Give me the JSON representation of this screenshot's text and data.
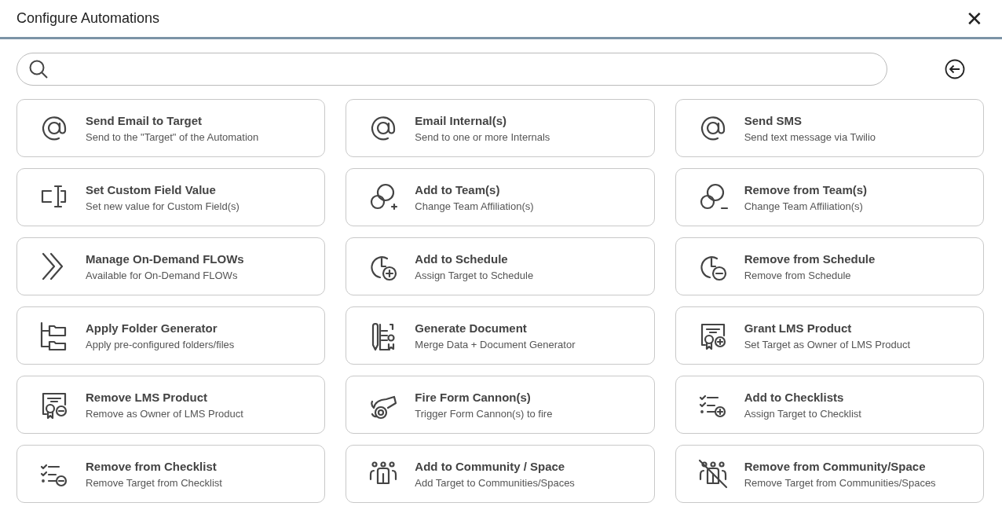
{
  "dialog": {
    "title": "Configure Automations",
    "close_symbol": "✕"
  },
  "automations": [
    {
      "kind": "at",
      "title": "Send Email to Target",
      "subtitle": "Send to the \"Target\" of the Automation"
    },
    {
      "kind": "at",
      "title": "Email Internal(s)",
      "subtitle": "Send to one or more Internals"
    },
    {
      "kind": "at",
      "title": "Send SMS",
      "subtitle": "Send text message via Twilio"
    },
    {
      "kind": "field",
      "title": "Set Custom Field Value",
      "subtitle": "Set new value for Custom Field(s)"
    },
    {
      "kind": "team-add",
      "title": "Add to Team(s)",
      "subtitle": "Change Team Affiliation(s)"
    },
    {
      "kind": "team-remove",
      "title": "Remove from Team(s)",
      "subtitle": "Change Team Affiliation(s)"
    },
    {
      "kind": "chevrons",
      "title": "Manage On-Demand FLOWs",
      "subtitle": "Available for On-Demand FLOWs"
    },
    {
      "kind": "schedule-add",
      "title": "Add to Schedule",
      "subtitle": "Assign Target to Schedule"
    },
    {
      "kind": "schedule-remove",
      "title": "Remove from Schedule",
      "subtitle": "Remove from Schedule"
    },
    {
      "kind": "folders",
      "title": "Apply Folder Generator",
      "subtitle": "Apply pre-configured folders/files"
    },
    {
      "kind": "document",
      "title": "Generate Document",
      "subtitle": "Merge Data + Document Generator"
    },
    {
      "kind": "certificate-add",
      "title": "Grant LMS Product",
      "subtitle": "Set Target as Owner of LMS Product"
    },
    {
      "kind": "certificate-remove",
      "title": "Remove LMS Product",
      "subtitle": "Remove as Owner of LMS Product"
    },
    {
      "kind": "cannon",
      "title": "Fire Form Cannon(s)",
      "subtitle": "Trigger Form Cannon(s) to fire"
    },
    {
      "kind": "checklist-add",
      "title": "Add to Checklists",
      "subtitle": "Assign Target to Checklist"
    },
    {
      "kind": "checklist-remove",
      "title": "Remove from Checklist",
      "subtitle": "Remove Target from Checklist"
    },
    {
      "kind": "community-add",
      "title": "Add to Community / Space",
      "subtitle": "Add Target to Communities/Spaces"
    },
    {
      "kind": "community-remove",
      "title": "Remove from Community/Space",
      "subtitle": "Remove Target from Communities/Spaces"
    }
  ]
}
